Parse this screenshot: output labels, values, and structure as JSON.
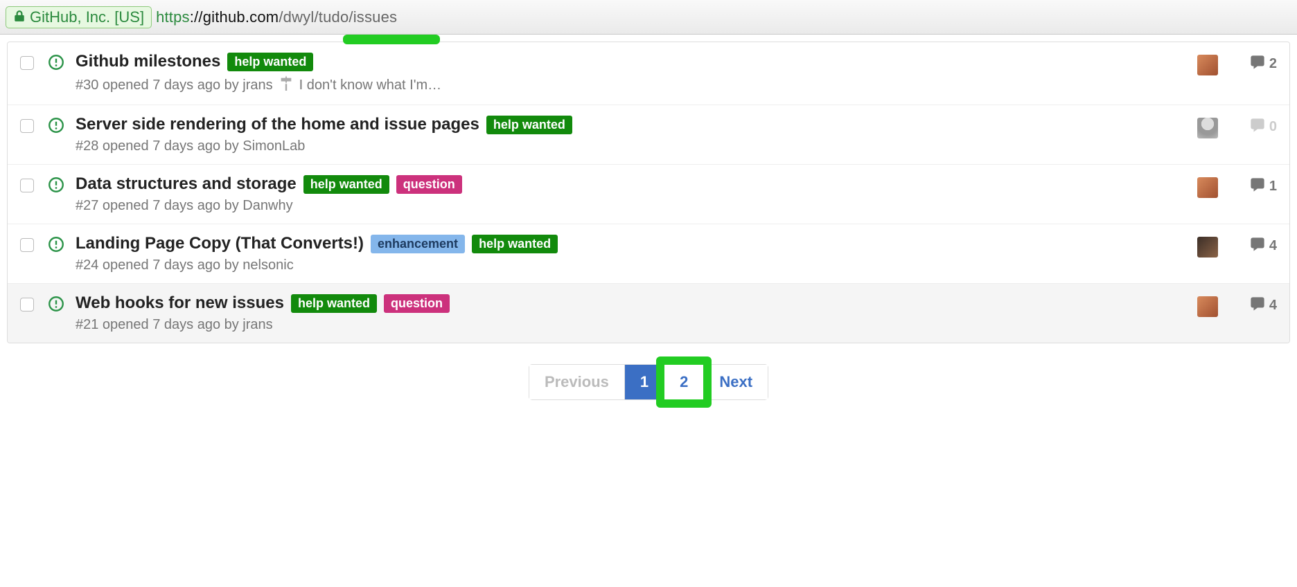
{
  "addr": {
    "ev_text": "GitHub, Inc. [US]",
    "proto": "https",
    "host": "://github.com",
    "path": "/dwyl/tudo/issues"
  },
  "labels": {
    "help": "help wanted",
    "question": "question",
    "enh": "enhancement"
  },
  "issues": [
    {
      "title": "Github milestones",
      "labels": [
        "help"
      ],
      "meta": "#30 opened 7 days ago by jrans",
      "milestone": "I don't know what I'm…",
      "avatar": "a",
      "comments": 2
    },
    {
      "title": "Server side rendering of the home and issue pages",
      "labels": [
        "help"
      ],
      "meta": "#28 opened 7 days ago by SimonLab",
      "milestone": "",
      "avatar": "b",
      "comments": 0
    },
    {
      "title": "Data structures and storage",
      "labels": [
        "help",
        "question"
      ],
      "meta": "#27 opened 7 days ago by Danwhy",
      "milestone": "",
      "avatar": "a",
      "comments": 1
    },
    {
      "title": "Landing Page Copy (That Converts!)",
      "labels": [
        "enh",
        "help"
      ],
      "meta": "#24 opened 7 days ago by nelsonic",
      "milestone": "",
      "avatar": "c",
      "comments": 4
    },
    {
      "title": "Web hooks for new issues",
      "labels": [
        "help",
        "question"
      ],
      "meta": "#21 opened 7 days ago by jrans",
      "milestone": "",
      "avatar": "a",
      "comments": 4,
      "hover": true
    }
  ],
  "pagination": {
    "prev": "Previous",
    "p1": "1",
    "p2": "2",
    "next": "Next"
  }
}
